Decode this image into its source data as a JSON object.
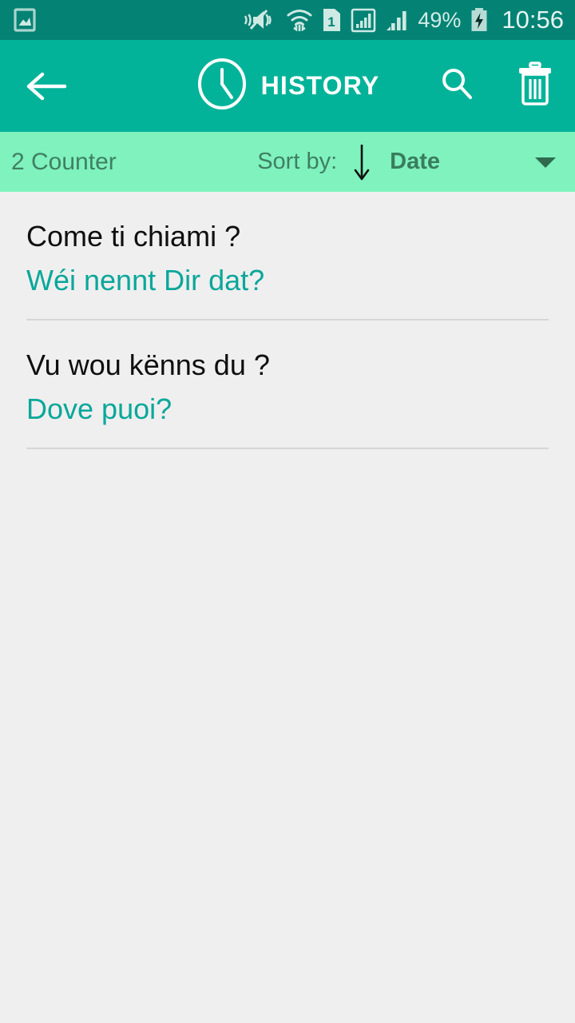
{
  "status_bar": {
    "left_icons": [
      {
        "name": "image-icon",
        "label": "picture"
      }
    ],
    "right_icons": [
      {
        "name": "mute-vibrate-icon",
        "label": "sound off"
      },
      {
        "name": "wifi-transfer-icon",
        "label": "wifi"
      },
      {
        "name": "sim-card-1-icon",
        "label": "1"
      },
      {
        "name": "signal-bars-boxed-icon",
        "label": "signal sim 1"
      },
      {
        "name": "signal-bars-icon",
        "label": "signal sim 2"
      }
    ],
    "battery_percent": "49%",
    "battery_charging": true,
    "time": "10:56",
    "bg_color": "#048375",
    "fg_color": "#d3ece6"
  },
  "app_bar": {
    "back_label": "back",
    "clock_icon": "clock-icon",
    "title": "HISTORY",
    "search_label": "search",
    "delete_label": "delete all",
    "bg_color": "#02b399",
    "fg_color": "#ffffff"
  },
  "sort_bar": {
    "counter": "2 Counter",
    "sort_by_label": "Sort by:",
    "sort_direction": "descending",
    "sort_value": "Date",
    "dropdown_icon": "chevron-down-icon",
    "bg_color": "#7ff2be",
    "fg_color": "#3f7f63"
  },
  "history": {
    "items": [
      {
        "source_text": "Come ti chiami ?",
        "target_text": "Wéi nennt Dir dat?"
      },
      {
        "source_text": "Vu wou kënns du ?",
        "target_text": "Dove puoi?"
      }
    ],
    "source_color": "#0f0f0f",
    "target_color": "#0aa79a",
    "bg_color": "#efefef"
  }
}
